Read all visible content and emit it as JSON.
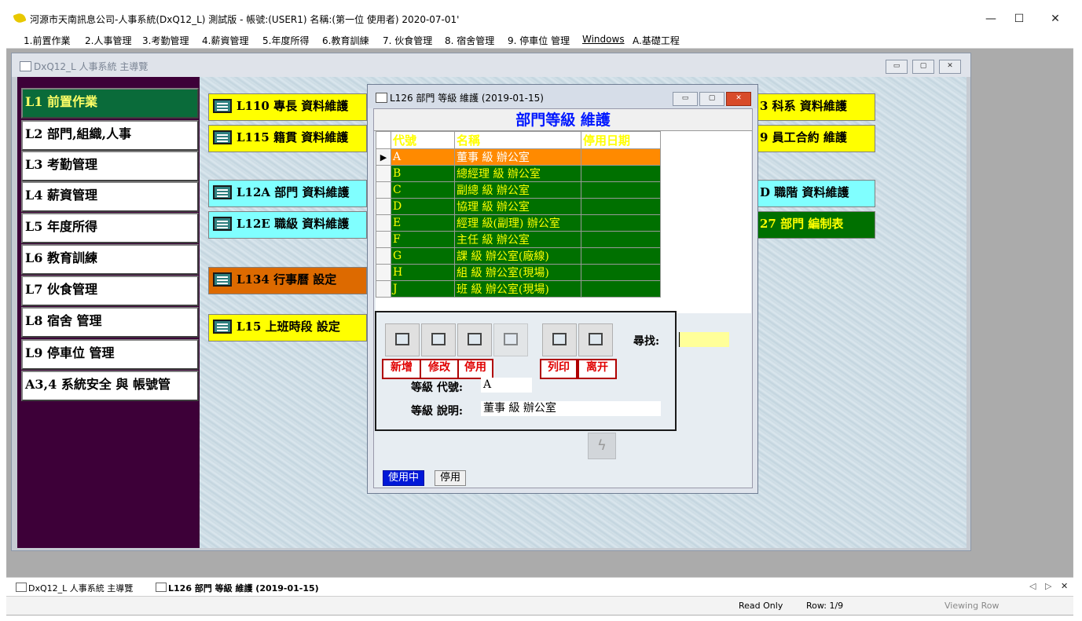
{
  "window": {
    "title": "河源市天南訊息公司-人事系統(DxQ12_L) 測試版 - 帳號:(USER1) 名稱:(第一位 使用者) 2020-07-01'",
    "minimize": "—",
    "maximize": "☐",
    "close": "✕"
  },
  "menu": [
    "1.前置作業",
    "2.人事管理",
    "3.考勤管理",
    "4.薪資管理",
    "5.年度所得",
    "6.教育訓練",
    "7. 伙食管理",
    "8. 宿舍管理",
    "9. 停車位 管理",
    "Windows",
    "A.基礎工程"
  ],
  "main_window": {
    "title": "DxQ12_L 人事系統 主導覽",
    "nav": [
      "L1 前置作業",
      "L2 部門,組織,人事",
      "L3 考勤管理",
      "L4 薪資管理",
      "L5 年度所得",
      "L6 教育訓練",
      "L7 伙食管理",
      "L8 宿舍 管理",
      "L9 停車位 管理",
      "A3,4 系統安全 與 帳號管"
    ],
    "tiles_left": [
      "L110 專長 資料維護",
      "L115 籍貫 資料維護",
      "L12A 部門 資料維護",
      "L12E 職級 資料維護",
      "L134 行事曆 設定",
      "L15 上班時段 設定"
    ],
    "tiles_right": [
      "3 科系 資料維護",
      "9 員工合約 維護",
      "D 職階 資料維護",
      "27 部門 編制表"
    ]
  },
  "dialog": {
    "title": "L126 部門 等級 維護 (2019-01-15)",
    "header": "部門等級 維護",
    "columns": [
      "代號",
      "名稱",
      "停用日期"
    ],
    "rows": [
      {
        "code": "A",
        "name": "董事 級 辦公室",
        "date": "",
        "selected": true
      },
      {
        "code": "B",
        "name": "總經理 級 辦公室",
        "date": ""
      },
      {
        "code": "C",
        "name": "副總 級 辦公室",
        "date": ""
      },
      {
        "code": "D",
        "name": "協理 級 辦公室",
        "date": ""
      },
      {
        "code": "E",
        "name": "經理 級(副理) 辦公室",
        "date": ""
      },
      {
        "code": "F",
        "name": "主任 級 辦公室",
        "date": ""
      },
      {
        "code": "G",
        "name": "課 級 辦公室(廠線)",
        "date": ""
      },
      {
        "code": "H",
        "name": "組 級 辦公室(現場)",
        "date": ""
      },
      {
        "code": "J",
        "name": "班 級 辦公室(現場)",
        "date": ""
      }
    ],
    "buttons": {
      "add": "新增",
      "edit": "修改",
      "disable": "停用",
      "print": "列印",
      "leave": "离开"
    },
    "search_label": "尋找:",
    "search_value": "",
    "level_code_label": "等級 代號:",
    "level_code_value": "A",
    "level_desc_label": "等級 說明:",
    "level_desc_value": "董事 級 辦公室",
    "tabs": [
      "使用中",
      "停用"
    ]
  },
  "taskbar": {
    "items": [
      "DxQ12_L 人事系統 主導覽",
      "L126 部門 等級 維護 (2019-01-15)"
    ]
  },
  "status": {
    "mode": "Read Only",
    "row": "Row: 1/9",
    "state": "Viewing Row"
  }
}
